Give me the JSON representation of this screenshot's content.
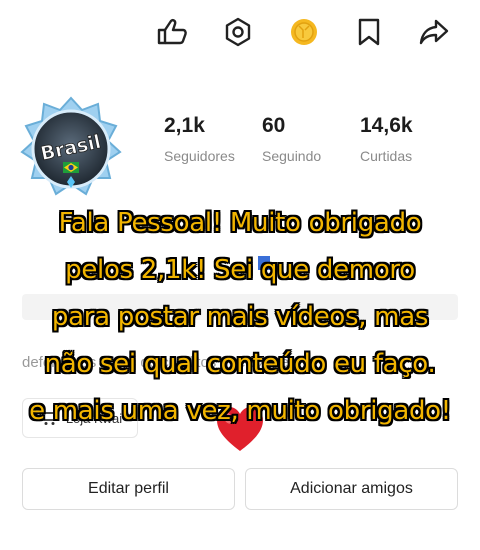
{
  "toolbar": {
    "icons": [
      "thumbs-up-icon",
      "hexagon-nut-icon",
      "coin-icon",
      "bookmark-icon",
      "share-icon"
    ]
  },
  "profile": {
    "avatar_text": "Brasil",
    "stats": [
      {
        "value": "2,1k",
        "label": "Seguidores"
      },
      {
        "value": "60",
        "label": "Seguindo"
      },
      {
        "value": "14,6k",
        "label": "Curtidas"
      }
    ],
    "bio_visible": "defendo os lados de conflitos que existem"
  },
  "shop": {
    "label": "Loja Kwai"
  },
  "buttons": {
    "edit": "Editar perfil",
    "add_friends": "Adicionar amigos"
  },
  "caption": {
    "lines": [
      "Fala Pessoal! Muito obrigado",
      "pelos 2,1k! Sei que demoro",
      "para postar mais vídeos, mas",
      "não sei qual conteúdo eu faço.",
      "e mais uma vez, muito obrigado!"
    ]
  },
  "colors": {
    "caption_text": "#f2b500",
    "caption_stroke": "#000000",
    "heart": "#e0202c",
    "coin": "#f5b820"
  }
}
